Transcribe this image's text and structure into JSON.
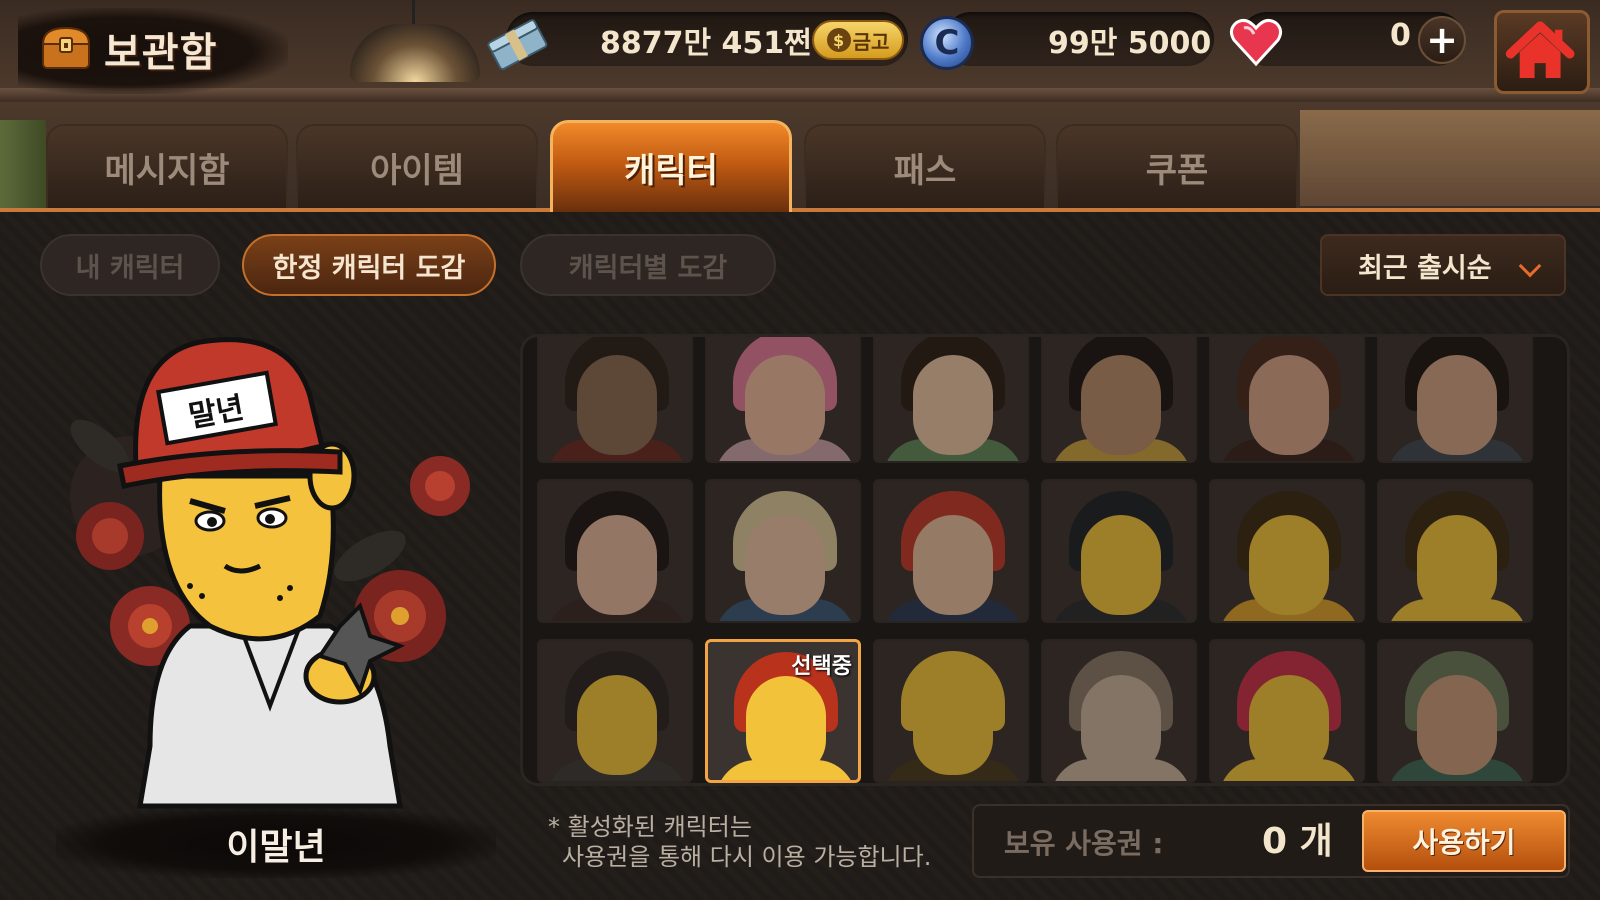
{
  "header": {
    "title": "보관함",
    "money": "8877만 451쩐",
    "gold_label": "금고",
    "gold_coin_symbol": "$",
    "c_coin_symbol": "C",
    "cash": "99만 5000",
    "hearts": "0",
    "plus_symbol": "+"
  },
  "tabs": [
    {
      "label": "메시지함",
      "active": false
    },
    {
      "label": "아이템",
      "active": false
    },
    {
      "label": "캐릭터",
      "active": true
    },
    {
      "label": "패스",
      "active": false
    },
    {
      "label": "쿠폰",
      "active": false
    }
  ],
  "subtabs": [
    {
      "label": "내 캐릭터",
      "active": false
    },
    {
      "label": "한정 캐릭터 도감",
      "active": true
    },
    {
      "label": "캐릭터별 도감",
      "active": false
    }
  ],
  "sort": {
    "label": "최근 출시순"
  },
  "showcase": {
    "name": "이말년",
    "hat_text": "말년"
  },
  "grid": {
    "selected_label": "선택중",
    "selected_index": 13,
    "cells": [
      {
        "skin": "#8a6a52",
        "hair": "#2b211b",
        "body": "#6b2a22"
      },
      {
        "skin": "#e8b99a",
        "hair": "#e07a9a",
        "body": "#c9a0a8"
      },
      {
        "skin": "#e7c2a2",
        "hair": "#2a2018",
        "body": "#5f8a5a"
      },
      {
        "skin": "#b58c6a",
        "hair": "#1c1714",
        "body": "#c9a040"
      },
      {
        "skin": "#d3a487",
        "hair": "#4a2a20",
        "body": "#3a2420"
      },
      {
        "skin": "#cfa184",
        "hair": "#1d1714",
        "body": "#404a52"
      },
      {
        "skin": "#e1b79a",
        "hair": "#1e1816",
        "body": "#3a2a28"
      },
      {
        "skin": "#e9c2a4",
        "hair": "#d9c79a",
        "body": "#3d5a7a"
      },
      {
        "skin": "#e4bc9c",
        "hair": "#c23a2a",
        "body": "#2a3a55"
      },
      {
        "skin": "#f1c23a",
        "hair": "#1d2228",
        "body": "#2b2c30"
      },
      {
        "skin": "#f1c23a",
        "hair": "#3a2a12",
        "body": "#d9a02a"
      },
      {
        "skin": "#f1c23a",
        "hair": "#3b2a14",
        "body": "#f1c23a"
      },
      {
        "skin": "#f1c23a",
        "hair": "#2a2622",
        "body": "#3d3a38"
      },
      {
        "skin": "#f1c23a",
        "hair": "#b8321c",
        "body": "#f1c23a"
      },
      {
        "skin": "#f1c23a",
        "hair": "#f1c23a",
        "body": "#4a3a20"
      },
      {
        "skin": "#c9b29c",
        "hair": "#8a7a6a",
        "body": "#c9b29c"
      },
      {
        "skin": "#f1c23a",
        "hair": "#c9304a",
        "body": "#f1c23a"
      },
      {
        "skin": "#c99a78",
        "hair": "#6a7a5a",
        "body": "#3f6a58"
      }
    ]
  },
  "footer": {
    "notice_line1": "* 활성화된 캐릭터는",
    "notice_line2": "사용권을 통해 다시 이용 가능합니다.",
    "ticket_label": "보유 사용권 :",
    "ticket_count": "0 개",
    "use_button": "사용하기"
  },
  "colors": {
    "accent": "#e07a2a",
    "active_tab": "#c25b12",
    "selected_border": "#f2a544"
  }
}
